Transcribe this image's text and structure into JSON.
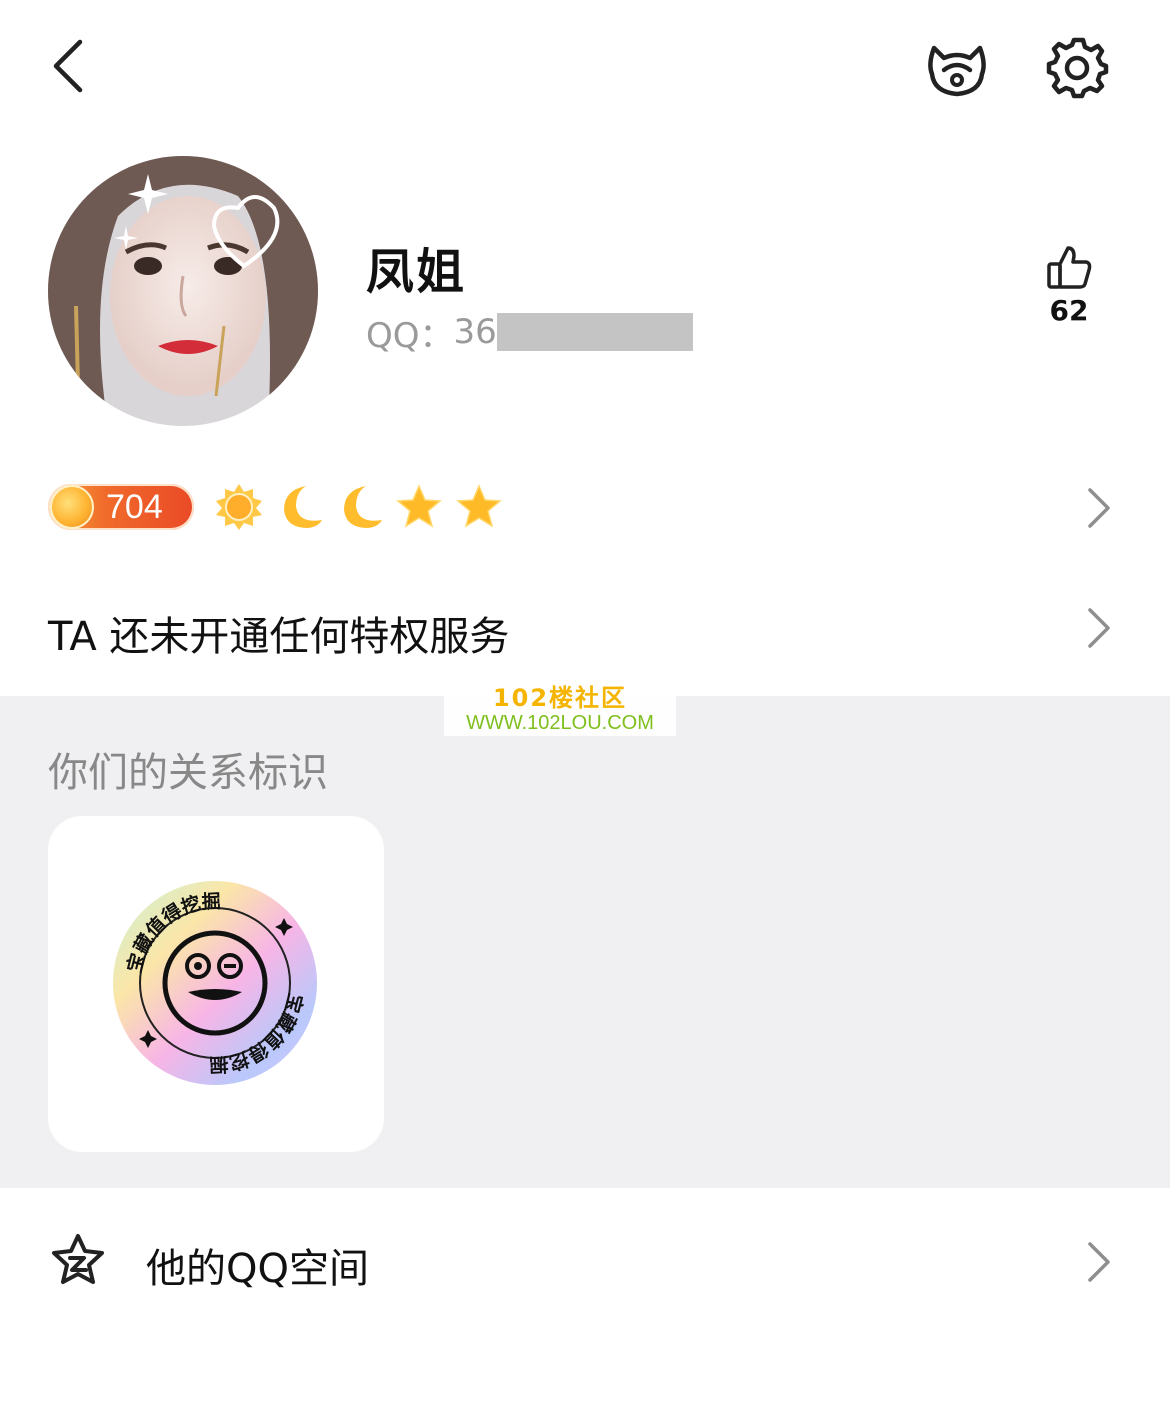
{
  "profile": {
    "nickname": "凤姐",
    "qq_label": "QQ：",
    "qq_visible": "36",
    "likes": "62"
  },
  "level": {
    "value": "704",
    "icons": [
      "sun-icon",
      "moon-icon",
      "moon-icon",
      "star-icon",
      "star-icon"
    ]
  },
  "privilege": {
    "text": "TA 还未开通任何特权服务"
  },
  "relationship": {
    "title": "你们的关系标识",
    "badge_text": "宝藏值得挖掘"
  },
  "watermark": {
    "line1": "102楼社区",
    "line2": "WWW.102LOU.COM"
  },
  "qzone": {
    "label": "他的QQ空间"
  },
  "colors": {
    "accent": "#f06a2a",
    "section_bg": "#f0f0f2",
    "secondary_text": "#9a9a9a"
  }
}
